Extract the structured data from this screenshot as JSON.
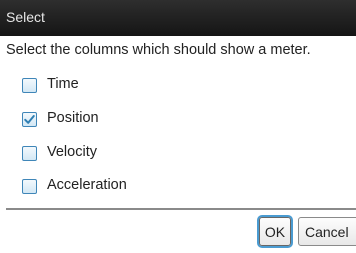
{
  "dialog": {
    "title": "Select",
    "prompt": "Select the columns which should show a meter.",
    "options": [
      {
        "label": "Time",
        "checked": false
      },
      {
        "label": "Position",
        "checked": true
      },
      {
        "label": "Velocity",
        "checked": false
      },
      {
        "label": "Acceleration",
        "checked": false
      }
    ],
    "buttons": {
      "ok_label": "OK",
      "cancel_label": "Cancel"
    }
  },
  "colors": {
    "titlebar": "#1e1e1e",
    "checkbox_border": "#3f86b8",
    "focus_ring": "#4a9bd1"
  }
}
